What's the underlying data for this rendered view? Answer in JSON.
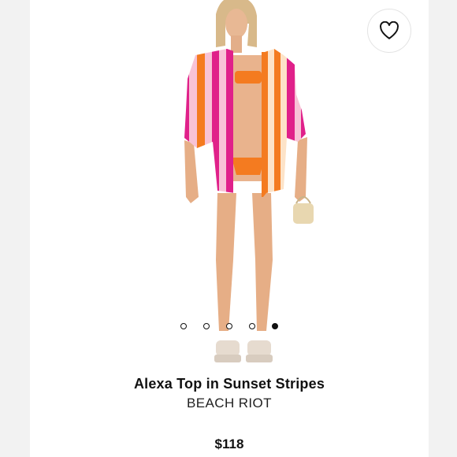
{
  "product": {
    "title": "Alexa Top in Sunset Stripes",
    "brand": "BEACH RIOT",
    "price": "$118",
    "image_alt": "Model wearing Alexa Top in Sunset Stripes"
  },
  "gallery": {
    "image_count": 5,
    "active_index": 4
  },
  "icons": {
    "wishlist": "heart-icon"
  },
  "colors": {
    "pink": "#f5a3c0",
    "magenta": "#e0218a",
    "orange": "#f47b20",
    "background": "#f2f2f2"
  }
}
